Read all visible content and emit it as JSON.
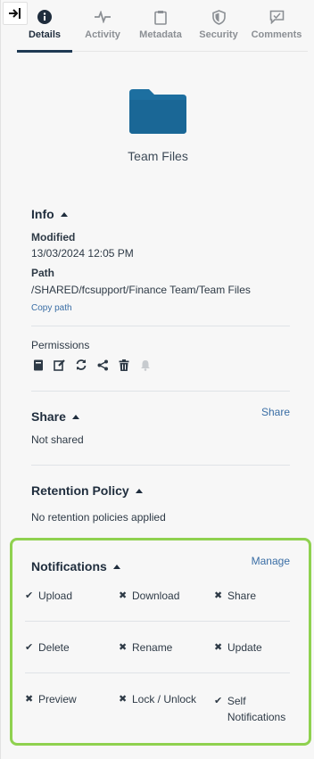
{
  "tabs": [
    {
      "label": "Details",
      "icon": "info-icon",
      "active": true
    },
    {
      "label": "Activity",
      "icon": "activity-icon"
    },
    {
      "label": "Metadata",
      "icon": "clipboard-icon"
    },
    {
      "label": "Security",
      "icon": "shield-icon"
    },
    {
      "label": "Comments",
      "icon": "comment-icon"
    }
  ],
  "folder": {
    "name": "Team Files",
    "color": "#1d6fa0"
  },
  "info": {
    "heading": "Info",
    "modified_label": "Modified",
    "modified_value": "13/03/2024 12:05 PM",
    "path_label": "Path",
    "path_value": "/SHARED/fcsupport/Finance Team/Team Files",
    "copy_path": "Copy path"
  },
  "permissions": {
    "label": "Permissions",
    "icons": [
      "book-icon",
      "edit-icon",
      "sync-icon",
      "share-icon",
      "trash-icon",
      "bell-icon"
    ]
  },
  "share": {
    "heading": "Share",
    "action": "Share",
    "value": "Not shared"
  },
  "retention": {
    "heading": "Retention Policy",
    "value": "No retention policies applied"
  },
  "notifications": {
    "heading": "Notifications",
    "action": "Manage",
    "highlight_color": "#8fd14f",
    "items": [
      {
        "label": "Upload",
        "enabled": true
      },
      {
        "label": "Download",
        "enabled": false
      },
      {
        "label": "Share",
        "enabled": false
      },
      {
        "label": "Delete",
        "enabled": true
      },
      {
        "label": "Rename",
        "enabled": false
      },
      {
        "label": "Update",
        "enabled": false
      },
      {
        "label": "Preview",
        "enabled": false
      },
      {
        "label": "Lock / Unlock",
        "enabled": false
      },
      {
        "label": "Self Notifications",
        "enabled": true
      }
    ]
  }
}
